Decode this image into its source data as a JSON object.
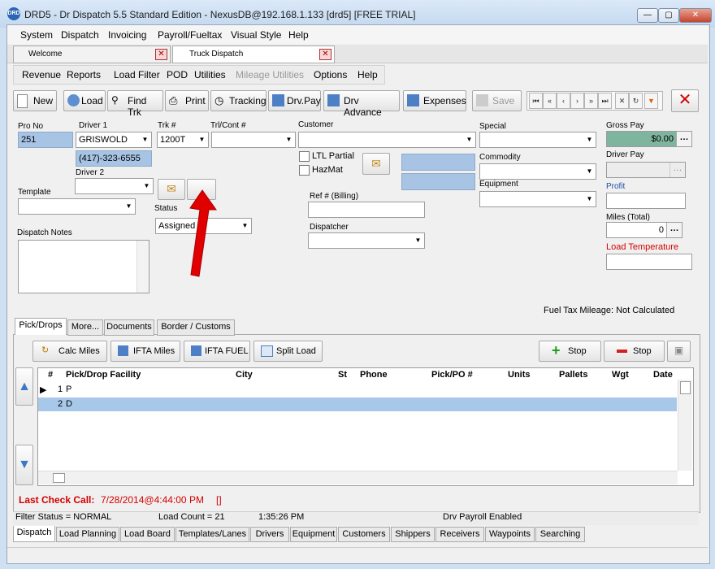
{
  "window": {
    "title": "DRD5 - Dr Dispatch 5.5 Standard Edition - NexusDB@192.168.1.133 [drd5] [FREE TRIAL]",
    "app_icon_text": "DRD",
    "min": "—",
    "max": "▢",
    "close": "✕"
  },
  "menu": [
    "System",
    "Dispatch",
    "Invoicing",
    "Payroll/Fueltax",
    "Visual Style",
    "Help"
  ],
  "doc_tabs": [
    "Welcome",
    "Truck Dispatch"
  ],
  "submenu": [
    "Revenue",
    "Reports",
    "Load Filter",
    "POD",
    "Utilities",
    "Mileage Utilities",
    "Options",
    "Help"
  ],
  "toolbar": {
    "new": "New",
    "load": "Load",
    "find_trk": "Find Trk",
    "print": "Print",
    "tracking": "Tracking",
    "drv_pay": "Drv.Pay",
    "drv_advance": "Drv Advance",
    "expenses": "Expenses",
    "save": "Save"
  },
  "form": {
    "pro_no_label": "Pro No",
    "pro_no": "251",
    "driver1_label": "Driver 1",
    "driver1": "GRISWOLD",
    "driver_phone": "(417)-323-6555",
    "driver2_label": "Driver 2",
    "trk_label": "Trk #",
    "trk": "1200T",
    "trl_label": "Trl/Cont #",
    "customer_label": "Customer",
    "ltl": "LTL Partial",
    "hazmat": "HazMat",
    "ref_label": "Ref # (Billing)",
    "dispatcher_label": "Dispatcher",
    "special_label": "Special",
    "commodity_label": "Commodity",
    "equipment_label": "Equipment",
    "gross_pay_label": "Gross Pay",
    "gross_pay": "$0.00",
    "driver_pay_label": "Driver Pay",
    "profit_label": "Profit",
    "miles_label": "Miles (Total)",
    "miles": "0",
    "load_temp_label": "Load Temperature",
    "template_label": "Template",
    "status_label": "Status",
    "status": "Assigned",
    "notes_label": "Dispatch Notes",
    "fuel_tax": "Fuel Tax Mileage:  Not Calculated"
  },
  "sub_tabs": [
    "Pick/Drops",
    "More...",
    "Documents",
    "Border / Customs"
  ],
  "grid_buttons": {
    "calc_miles": "Calc Miles",
    "ifta_miles": "IFTA Miles",
    "ifta_fuel": "IFTA FUEL",
    "split_load": "Split Load",
    "add_stop": "Stop",
    "del_stop": "Stop"
  },
  "grid": {
    "columns": [
      "#",
      "Pick/Drop Facility",
      "City",
      "St",
      "Phone",
      "Pick/PO #",
      "Units",
      "Pallets",
      "Wgt",
      "Date"
    ],
    "rows": [
      {
        "num": "1",
        "type": "P"
      },
      {
        "num": "2",
        "type": "D"
      }
    ]
  },
  "last_check": {
    "label": "Last Check Call:",
    "value": "7/28/2014@4:44:00 PM",
    "extra": "[]"
  },
  "status_bar": {
    "filter": "Filter Status = NORMAL",
    "count": "Load Count = 21",
    "time": "1:35:26 PM",
    "payroll": "Drv Payroll Enabled"
  },
  "bottom_tabs": [
    "Dispatch",
    "Load Planning",
    "Load Board",
    "Templates/Lanes",
    "Drivers",
    "Equipment",
    "Customers",
    "Shippers",
    "Receivers",
    "Waypoints",
    "Searching"
  ],
  "colors": {
    "accent_red": "#d40000",
    "gross_pay_bg": "#7fb59f",
    "selected_row": "#a8c8ea"
  }
}
